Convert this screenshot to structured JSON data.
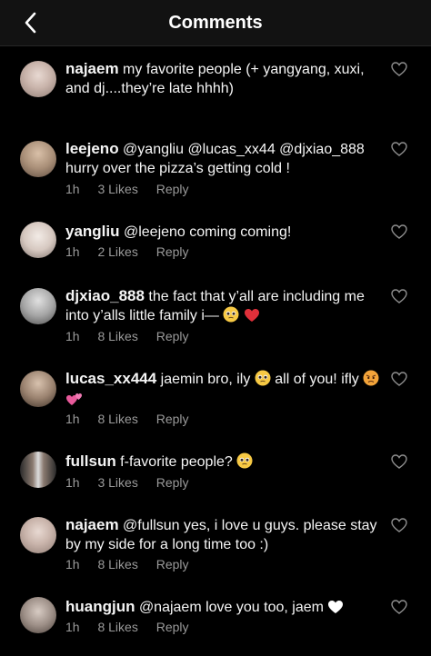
{
  "header": {
    "title": "Comments"
  },
  "comments": [
    {
      "user": "najaem",
      "text": "my favorite people (+ yangyang, xuxi, and dj....they’re late hhhh)",
      "time": "",
      "likes": "",
      "reply": ""
    },
    {
      "user": "leejeno",
      "text": "@yangliu @lucas_xx44 @djxiao_888 hurry over the pizza’s getting cold !",
      "time": "1h",
      "likes": "3 Likes",
      "reply": "Reply"
    },
    {
      "user": "yangliu",
      "text": "@leejeno coming coming!",
      "time": "1h",
      "likes": "2 Likes",
      "reply": "Reply"
    },
    {
      "user": "djxiao_888",
      "text": "the fact that y’all are including me into y’alls little family i—",
      "time": "1h",
      "likes": "8 Likes",
      "reply": "Reply"
    },
    {
      "user": "lucas_xx444",
      "text": "jaemin bro, ily",
      "text2": "all of you! ifly",
      "time": "1h",
      "likes": "8 Likes",
      "reply": "Reply"
    },
    {
      "user": "fullsun",
      "text": "f-favorite people?",
      "time": "1h",
      "likes": "3 Likes",
      "reply": "Reply"
    },
    {
      "user": "najaem",
      "text": "@fullsun yes, i love u guys. please stay by my side for a long time too :)",
      "time": "1h",
      "likes": "8 Likes",
      "reply": "Reply"
    },
    {
      "user": "huangjun",
      "text": "@najaem love you too, jaem",
      "time": "1h",
      "likes": "8 Likes",
      "reply": "Reply"
    }
  ]
}
